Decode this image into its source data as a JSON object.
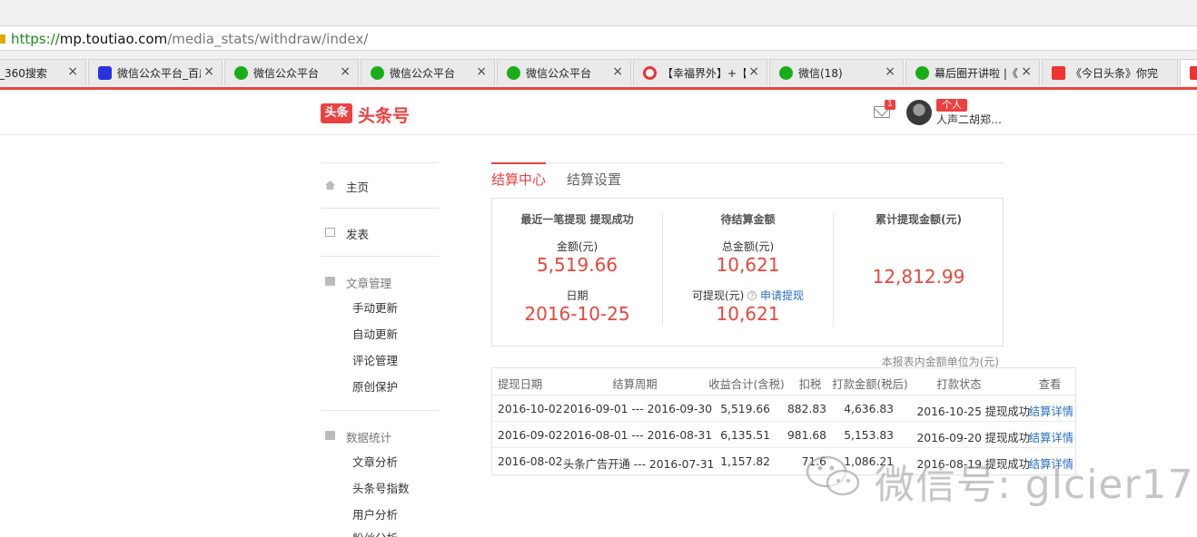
{
  "browser": {
    "url": {
      "scheme": "https://",
      "domain": "mp.toutiao.com",
      "path": "/media_stats/withdraw/index/"
    },
    "tabs": [
      {
        "title": "_360搜索",
        "icon": "none"
      },
      {
        "title": "微信公众平台_百度",
        "icon": "baidu-icon"
      },
      {
        "title": "微信公众平台",
        "icon": "wechat-icon"
      },
      {
        "title": "微信公众平台",
        "icon": "wechat-icon"
      },
      {
        "title": "微信公众平台",
        "icon": "wechat-icon"
      },
      {
        "title": "【幸福界外】+【",
        "icon": "360-icon"
      },
      {
        "title": "微信(18)",
        "icon": "wechat-icon"
      },
      {
        "title": "幕后圈开讲啦 |《",
        "icon": "wechat-icon"
      },
      {
        "title": "《今日头条》你完",
        "icon": "toutiao-icon"
      }
    ],
    "close_glyph": "×",
    "accent_color": "#e8473c"
  },
  "header": {
    "logo_mark": "头条",
    "logo_text": "头条号",
    "mail_count": "1",
    "role_badge": "个人",
    "username": "人声二胡郑…"
  },
  "nav": {
    "home": "主页",
    "publish": "发表",
    "article_mgmt": "文章管理",
    "article_items": [
      "手动更新",
      "自动更新",
      "评论管理",
      "原创保护"
    ],
    "data_stats": "数据统计",
    "data_items": [
      "文章分析",
      "头条号指数",
      "用户分析",
      "粉丝分析"
    ]
  },
  "content": {
    "tabs": [
      "结算中心",
      "结算设置"
    ],
    "summary": {
      "last_withdraw": {
        "title": "最近一笔提现 提现成功",
        "amount_label": "金额(元)",
        "amount": "5,519.66",
        "date_label": "日期",
        "date": "2016-10-25"
      },
      "pending": {
        "title": "待结算金额",
        "total_label": "总金额(元)",
        "total": "10,621",
        "withdrawable_label": "可提现(元)",
        "help_glyph": "?",
        "apply_link": "申请提现",
        "withdrawable": "10,621"
      },
      "cumulative": {
        "title": "累计提现金额(元)",
        "amount": "12,812.99"
      }
    },
    "unit_note": "本报表内金额单位为(元)",
    "table": {
      "headers": [
        "提现日期",
        "结算周期",
        "收益合计(含税)",
        "扣税",
        "打款金额(税后)",
        "打款状态",
        "查看"
      ],
      "rows": [
        [
          "2016-10-02",
          "2016-09-01 --- 2016-09-30",
          "5,519.66",
          "882.83",
          "4,636.83",
          "2016-10-25 提现成功",
          "结算详情"
        ],
        [
          "2016-09-02",
          "2016-08-01 --- 2016-08-31",
          "6,135.51",
          "981.68",
          "5,153.83",
          "2016-09-20 提现成功",
          "结算详情"
        ],
        [
          "2016-08-02",
          "头条广告开通 --- 2016-07-31",
          "1,157.82",
          "71.6",
          "1,086.21",
          "2016-08-19 提现成功",
          "结算详情"
        ]
      ]
    }
  },
  "watermark": {
    "text": "微信号: glcier17"
  }
}
